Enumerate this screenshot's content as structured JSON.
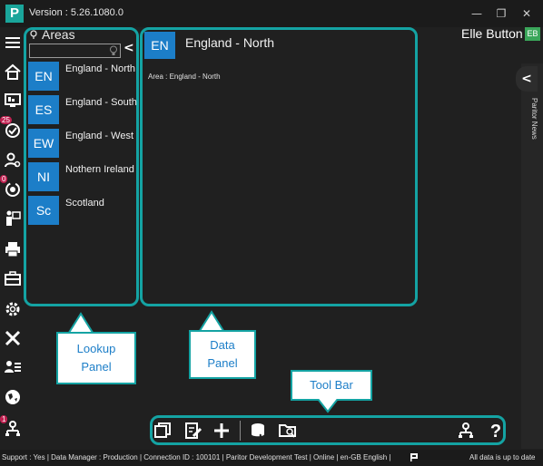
{
  "app": {
    "logo_letter": "P",
    "version": "Version : 5.26.1080.0",
    "window_controls": {
      "minimize": "—",
      "maximize": "❐",
      "close": "✕"
    }
  },
  "user": {
    "name": "Elle Button",
    "initials": "EB"
  },
  "nav": {
    "badges": {
      "tasks": "25",
      "sync": "0",
      "account": "1"
    }
  },
  "lookup": {
    "title": "Areas",
    "search_value": "",
    "items": [
      {
        "code": "EN",
        "label": "England - North"
      },
      {
        "code": "ES",
        "label": "England - South"
      },
      {
        "code": "EW",
        "label": "England - West"
      },
      {
        "code": "NI",
        "label": "Nothern Ireland"
      },
      {
        "code": "Sc",
        "label": "Scotland"
      }
    ]
  },
  "data_panel": {
    "code": "EN",
    "title": "England - North",
    "area_line": "Area : England - North"
  },
  "news": {
    "label": "Paritor News"
  },
  "callouts": {
    "lookup": "Lookup Panel",
    "data": "Data Panel",
    "toolbar": "Tool Bar"
  },
  "status": {
    "left": "Support : Yes | Data Manager : Production | Connection ID : 100101 | Paritor Development Test | Online | en-GB English |",
    "right": "All data is up to date"
  },
  "colors": {
    "accent": "#14a3a3",
    "tile": "#1c7ec8",
    "background": "#202020",
    "logo": "#1aa59b",
    "badge": "#c02050"
  }
}
